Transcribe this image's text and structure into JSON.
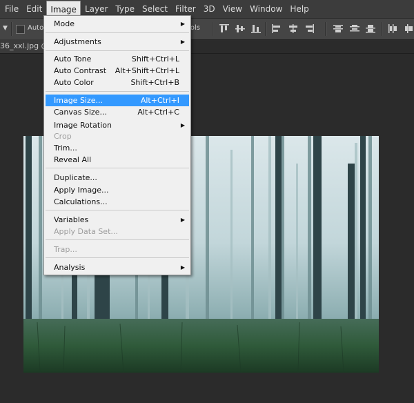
{
  "menubar": {
    "items": [
      "File",
      "Edit",
      "Image",
      "Layer",
      "Type",
      "Select",
      "Filter",
      "3D",
      "View",
      "Window",
      "Help"
    ],
    "active": "Image"
  },
  "options_bar": {
    "auto_label": "Auto-",
    "controls_label": "rols"
  },
  "document": {
    "tab_label": "36_xxl.jpg @"
  },
  "image_menu": {
    "items": [
      {
        "label": "Mode",
        "shortcut": "",
        "submenu": true,
        "disabled": false
      },
      {
        "label": "Adjustments",
        "shortcut": "",
        "submenu": true,
        "disabled": false
      },
      {
        "label": "Auto Tone",
        "shortcut": "Shift+Ctrl+L",
        "submenu": false,
        "disabled": false
      },
      {
        "label": "Auto Contrast",
        "shortcut": "Alt+Shift+Ctrl+L",
        "submenu": false,
        "disabled": false
      },
      {
        "label": "Auto Color",
        "shortcut": "Shift+Ctrl+B",
        "submenu": false,
        "disabled": false
      },
      {
        "label": "Image Size...",
        "shortcut": "Alt+Ctrl+I",
        "submenu": false,
        "disabled": false,
        "highlighted": true
      },
      {
        "label": "Canvas Size...",
        "shortcut": "Alt+Ctrl+C",
        "submenu": false,
        "disabled": false
      },
      {
        "label": "Image Rotation",
        "shortcut": "",
        "submenu": true,
        "disabled": false
      },
      {
        "label": "Crop",
        "shortcut": "",
        "submenu": false,
        "disabled": true
      },
      {
        "label": "Trim...",
        "shortcut": "",
        "submenu": false,
        "disabled": false
      },
      {
        "label": "Reveal All",
        "shortcut": "",
        "submenu": false,
        "disabled": false
      },
      {
        "label": "Duplicate...",
        "shortcut": "",
        "submenu": false,
        "disabled": false
      },
      {
        "label": "Apply Image...",
        "shortcut": "",
        "submenu": false,
        "disabled": false
      },
      {
        "label": "Calculations...",
        "shortcut": "",
        "submenu": false,
        "disabled": false
      },
      {
        "label": "Variables",
        "shortcut": "",
        "submenu": true,
        "disabled": false
      },
      {
        "label": "Apply Data Set...",
        "shortcut": "",
        "submenu": false,
        "disabled": true
      },
      {
        "label": "Trap...",
        "shortcut": "",
        "submenu": false,
        "disabled": true
      },
      {
        "label": "Analysis",
        "shortcut": "",
        "submenu": true,
        "disabled": false
      }
    ]
  },
  "colors": {
    "highlight": "#3399ff",
    "menu_bg": "#f0f0f0",
    "app_bg": "#2b2b2b"
  },
  "icons": [
    "tool-dropdown-arrow-icon",
    "align-top-icon",
    "align-vcenter-icon",
    "align-bottom-icon",
    "align-left-icon",
    "align-hcenter-icon",
    "align-right-icon",
    "distribute-top-icon",
    "distribute-vcenter-icon",
    "distribute-bottom-icon",
    "distribute-left-icon",
    "distribute-hcenter-icon",
    "submenu-arrow-icon"
  ]
}
